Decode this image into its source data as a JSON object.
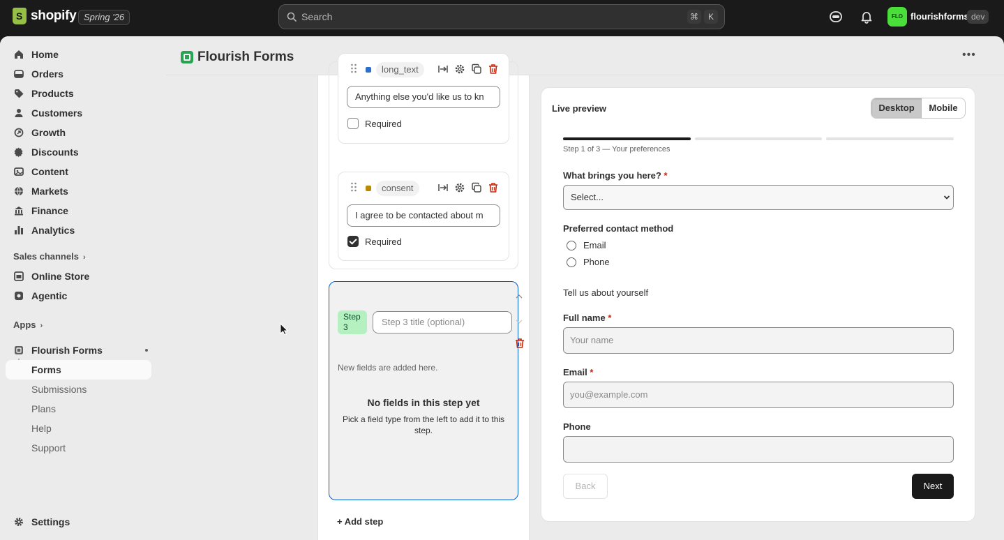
{
  "topbar": {
    "logo_text": "shopify",
    "edition_badge": "Spring '26",
    "search_placeholder": "Search",
    "shortcut_keys": [
      "⌘",
      "K"
    ],
    "store_avatar": "FLO",
    "store_name": "flourishforms",
    "env_badge": "dev"
  },
  "sidebar": {
    "items": [
      {
        "label": "Home",
        "icon": "home-icon"
      },
      {
        "label": "Orders",
        "icon": "orders-icon"
      },
      {
        "label": "Products",
        "icon": "tag-icon"
      },
      {
        "label": "Customers",
        "icon": "person-icon"
      },
      {
        "label": "Growth",
        "icon": "growth-icon"
      },
      {
        "label": "Discounts",
        "icon": "discount-icon"
      },
      {
        "label": "Content",
        "icon": "content-icon"
      },
      {
        "label": "Markets",
        "icon": "globe-icon"
      },
      {
        "label": "Finance",
        "icon": "bank-icon"
      },
      {
        "label": "Analytics",
        "icon": "chart-icon"
      }
    ],
    "sales_channels_label": "Sales channels",
    "channels": [
      {
        "label": "Online Store",
        "icon": "store-icon"
      },
      {
        "label": "Agentic",
        "icon": "agentic-icon"
      }
    ],
    "apps_label": "Apps",
    "app": {
      "label": "Flourish Forms",
      "icon": "app-icon"
    },
    "app_sub": [
      {
        "label": "Forms"
      },
      {
        "label": "Submissions"
      },
      {
        "label": "Plans"
      },
      {
        "label": "Help"
      },
      {
        "label": "Support"
      }
    ],
    "settings_label": "Settings"
  },
  "header": {
    "title": "Flourish Forms",
    "more_label": "•••"
  },
  "builder": {
    "fields": [
      {
        "tag": "long_text",
        "color": "#2c6ecb",
        "value": "Anything else you'd like us to kn",
        "required_label": "Required",
        "required": false
      },
      {
        "tag": "consent",
        "color": "#b98900",
        "value": "I agree to be contacted about m",
        "required_label": "Required",
        "required": true
      }
    ],
    "step3": {
      "badge": "Step 3",
      "title_placeholder": "Step 3 title (optional)",
      "hint": "New fields are added here.",
      "empty_title": "No fields in this step yet",
      "empty_sub": "Pick a field type from the left to add it to this step."
    },
    "add_step_label": "+ Add step"
  },
  "preview": {
    "title": "Live preview",
    "toggle": {
      "desktop": "Desktop",
      "mobile": "Mobile",
      "selected": "Desktop"
    },
    "progress": {
      "current": 1,
      "total": 3
    },
    "step_note": "Step 1 of 3 — Your preferences",
    "q1_label": "What brings you here?",
    "q1_select": "Select...",
    "contact_label": "Preferred contact method",
    "contact_options": [
      "Email",
      "Phone"
    ],
    "about_label": "Tell us about yourself",
    "fullname_label": "Full name",
    "fullname_placeholder": "Your name",
    "email_label": "Email",
    "email_placeholder": "you@example.com",
    "phone_label": "Phone",
    "phone_placeholder": "",
    "required_mark": "*",
    "back_label": "Back",
    "next_label": "Next"
  }
}
